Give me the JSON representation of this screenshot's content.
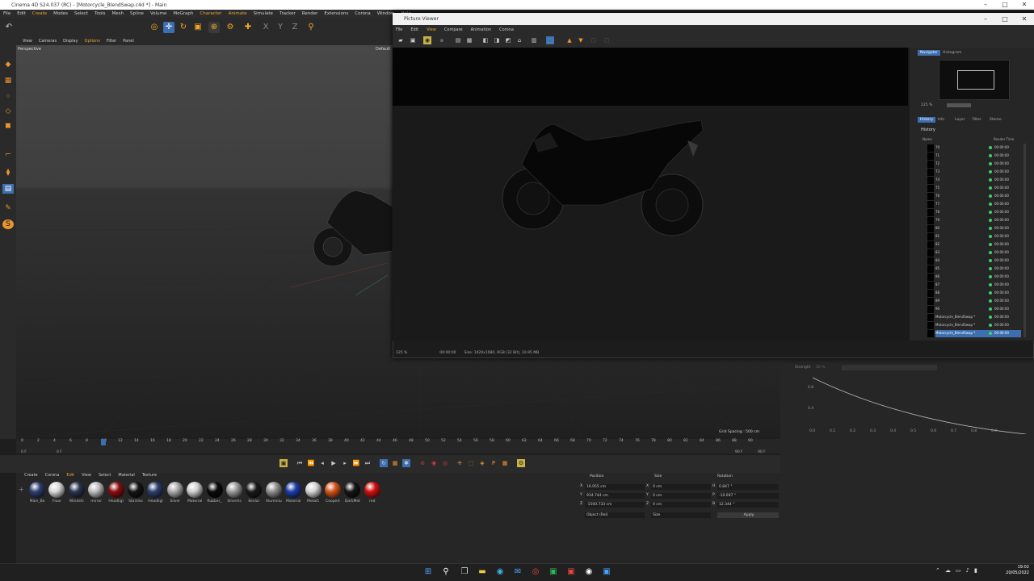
{
  "app": {
    "title": "Cinema 4D S24.037 (RC) - [Motorcycle_BlendSwap.c4d *] - Main",
    "menu": [
      "File",
      "Edit",
      "Create",
      "Modes",
      "Select",
      "Tools",
      "Mesh",
      "Spline",
      "Volume",
      "MoGraph",
      "Character",
      "Animate",
      "Simulate",
      "Tracker",
      "Render",
      "Extensions",
      "Corona",
      "Window",
      "Help"
    ]
  },
  "viewport": {
    "menu": [
      "View",
      "Cameras",
      "Display",
      "Options",
      "Filter",
      "Panel"
    ],
    "label": "Perspective",
    "camera": "Default",
    "grid_spacing": "Grid Spacing : 500 cm"
  },
  "timeline": {
    "ticks": [
      "0",
      "2",
      "4",
      "6",
      "8",
      "10",
      "12",
      "14",
      "16",
      "18",
      "20",
      "22",
      "24",
      "26",
      "28",
      "30",
      "32",
      "34",
      "36",
      "38",
      "40",
      "42",
      "44",
      "46",
      "48",
      "50",
      "52",
      "54",
      "56",
      "58",
      "60",
      "62",
      "64",
      "66",
      "68",
      "70",
      "72",
      "74",
      "76",
      "78",
      "80",
      "82",
      "84",
      "86",
      "88",
      "90"
    ],
    "start": "0 F",
    "start2": "0 F",
    "end": "90 F",
    "end2": "90 F",
    "current_fraction": 0.108
  },
  "materials": {
    "menu": [
      "Create",
      "Corona",
      "Edit",
      "View",
      "Select",
      "Material",
      "Texture"
    ],
    "items": [
      {
        "label": "Main_Bo",
        "color": "#2d3f6e"
      },
      {
        "label": "Floor",
        "color": "#d8d8d8"
      },
      {
        "label": "Windshi",
        "color": "#2a3550"
      },
      {
        "label": "mirror",
        "color": "#bcbcbc"
      },
      {
        "label": "Headligl",
        "color": "#8a0d10"
      },
      {
        "label": "Stainles",
        "color": "#141414"
      },
      {
        "label": "Headligl",
        "color": "#2d3f6e"
      },
      {
        "label": "Silver",
        "color": "#aaaaaa"
      },
      {
        "label": "Material",
        "color": "#cfcfcf"
      },
      {
        "label": "Rubber_",
        "color": "#0a0a0a"
      },
      {
        "label": "Silverlis",
        "color": "#9a9a9a"
      },
      {
        "label": "Kevlar",
        "color": "#1a1a1a"
      },
      {
        "label": "Aluminiu",
        "color": "#8e8e8e"
      },
      {
        "label": "Material",
        "color": "#1d3eaa"
      },
      {
        "label": "Metal1",
        "color": "#d4d4d4"
      },
      {
        "label": "Coopert",
        "color": "#d4531a"
      },
      {
        "label": "DarkMet",
        "color": "#151515"
      },
      {
        "label": "red",
        "color": "#d01010"
      }
    ]
  },
  "attributes": {
    "headers": {
      "position": "Position",
      "size": "Size",
      "rotation": "Rotation"
    },
    "rows": [
      {
        "axis": "X",
        "pos": "16.955 cm",
        "saxis": "X",
        "size": "0 cm",
        "raxis": "H",
        "rot": "0.847 °"
      },
      {
        "axis": "Y",
        "pos": "934.744 cm",
        "saxis": "Y",
        "size": "0 cm",
        "raxis": "P",
        "rot": "-10.697 °"
      },
      {
        "axis": "Z",
        "pos": "-1500.733 cm",
        "saxis": "Z",
        "size": "0 cm",
        "raxis": "B",
        "rot": "12.344 °"
      }
    ],
    "mode": "Object (Rel)",
    "size_mode": "Size",
    "apply": "Apply"
  },
  "picture_viewer": {
    "title": "Picture Viewer",
    "menu": [
      "File",
      "Edit",
      "View",
      "Compare",
      "Animation",
      "Corona"
    ],
    "zoom": "125 %",
    "status_time": "00:00:00",
    "status_size": "Size: 1920x1080, RGB (32 Bit), 10.95 MB",
    "side_tabs": [
      "Navigator",
      "Histogram"
    ],
    "side_zoom": "125 %",
    "history_tabs": [
      "History",
      "Info",
      "Layer",
      "Filter",
      "Stereo"
    ],
    "history_title": "History",
    "col_name": "Name",
    "col_time": "Render Time",
    "history": [
      {
        "name": "70",
        "time": "00:00:00"
      },
      {
        "name": "71",
        "time": "00:00:00"
      },
      {
        "name": "72",
        "time": "00:00:00"
      },
      {
        "name": "73",
        "time": "00:00:00"
      },
      {
        "name": "74",
        "time": "00:00:00"
      },
      {
        "name": "75",
        "time": "00:00:00"
      },
      {
        "name": "76",
        "time": "00:00:00"
      },
      {
        "name": "77",
        "time": "00:00:00"
      },
      {
        "name": "78",
        "time": "00:00:00"
      },
      {
        "name": "79",
        "time": "00:00:00"
      },
      {
        "name": "80",
        "time": "00:00:00"
      },
      {
        "name": "81",
        "time": "00:00:00"
      },
      {
        "name": "82",
        "time": "00:00:00"
      },
      {
        "name": "83",
        "time": "00:00:00"
      },
      {
        "name": "84",
        "time": "00:00:00"
      },
      {
        "name": "85",
        "time": "00:00:00"
      },
      {
        "name": "86",
        "time": "00:00:00"
      },
      {
        "name": "87",
        "time": "00:00:00"
      },
      {
        "name": "88",
        "time": "00:00:00"
      },
      {
        "name": "89",
        "time": "00:00:00"
      },
      {
        "name": "90",
        "time": "00:00:00"
      },
      {
        "name": "Motorcycle_BlendSwap *",
        "time": "00:00:00"
      },
      {
        "name": "Motorcycle_BlendSwap *",
        "time": "00:00:00"
      },
      {
        "name": "Motorcycle_BlendSwap *",
        "time": "00:00:00",
        "selected": true
      }
    ]
  },
  "right_panel": {
    "label": "Strength",
    "value": "50 %",
    "y_ticks": [
      "0.8",
      "0.4"
    ],
    "x_ticks": [
      "0.0",
      "0.1",
      "0.2",
      "0.3",
      "0.4",
      "0.5",
      "0.6",
      "0.7",
      "0.8",
      "0.9"
    ]
  },
  "taskbar": {
    "time": "19:02",
    "date": "20/05/2022"
  }
}
